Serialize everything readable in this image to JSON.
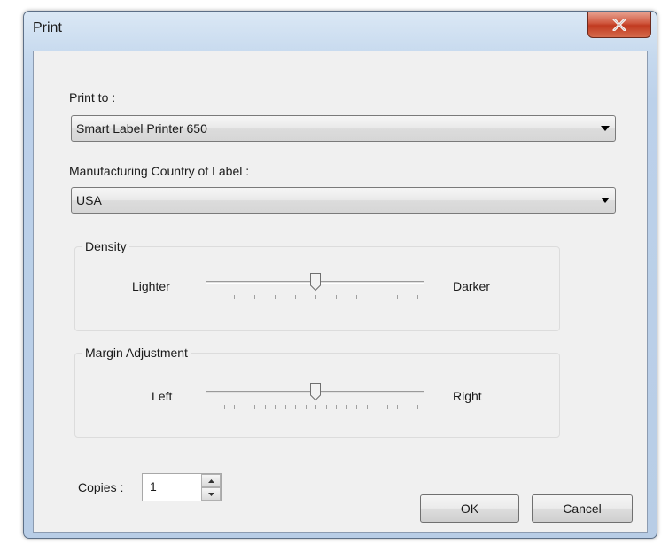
{
  "window": {
    "title": "Print"
  },
  "print_to": {
    "label": "Print to :",
    "selected": "Smart Label Printer 650"
  },
  "country": {
    "label": "Manufacturing Country of Label :",
    "selected": "USA"
  },
  "density": {
    "title": "Density",
    "left_label": "Lighter",
    "right_label": "Darker",
    "level": 0.5,
    "ticks": 11
  },
  "margin": {
    "title": "Margin Adjustment",
    "left_label": "Left",
    "right_label": "Right",
    "level": 0.5,
    "ticks": 21
  },
  "copies": {
    "label": "Copies :",
    "value": "1"
  },
  "buttons": {
    "ok": "OK",
    "cancel": "Cancel"
  },
  "icons": {
    "close": "close-icon",
    "dropdown": "chevron-down-icon",
    "spin_up": "spin-up-icon",
    "spin_down": "spin-down-icon"
  }
}
